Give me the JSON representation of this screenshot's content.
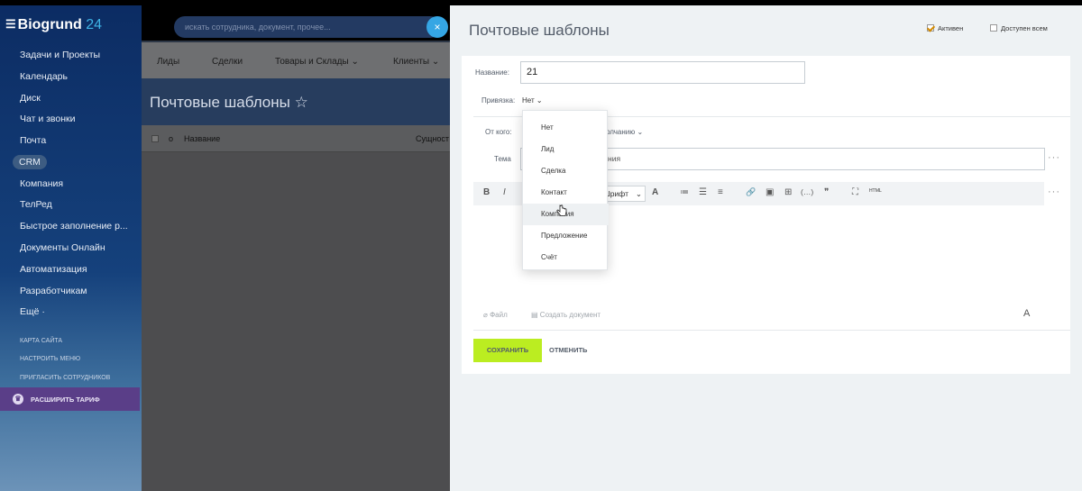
{
  "app": {
    "brand": "Biogrund",
    "brand_number": "24"
  },
  "search": {
    "placeholder": "искать сотрудника, документ, прочее...",
    "close_symbol": "×"
  },
  "sidebar": {
    "items": [
      {
        "label": "Задачи и Проекты"
      },
      {
        "label": "Календарь"
      },
      {
        "label": "Диск"
      },
      {
        "label": "Чат и звонки"
      },
      {
        "label": "Почта"
      },
      {
        "label": "CRM"
      },
      {
        "label": "Компания"
      },
      {
        "label": "ТелРед"
      },
      {
        "label": "Быстрое заполнение р..."
      },
      {
        "label": "Документы Онлайн"
      },
      {
        "label": "Автоматизация"
      },
      {
        "label": "Разработчикам"
      },
      {
        "label": "Ещё ·"
      }
    ],
    "links": [
      "КАРТА САЙТА",
      "НАСТРОИТЬ МЕНЮ",
      "ПРИГЛАСИТЬ СОТРУДНИКОВ"
    ],
    "upgrade_label": "РАСШИРИТЬ ТАРИФ"
  },
  "crm_tabs": [
    "Лиды",
    "Сделки",
    "Товары и Склады ⌄",
    "Клиенты ⌄"
  ],
  "page": {
    "title": "Почтовые шаблоны ☆"
  },
  "table": {
    "col_o": "о",
    "col_name": "Название",
    "col_entity": "Сущност"
  },
  "slider": {
    "title": "Почтовые шаблоны",
    "active_label": "Активен",
    "active_checked": true,
    "public_label": "Доступен всем",
    "public_checked": false
  },
  "form": {
    "name_label": "Название:",
    "name_value": "21",
    "binding_label": "Привязка:",
    "binding_value": "Нет",
    "from_label": "От кого:",
    "from_value": "олчанию ⌄",
    "subject_label": "Тема",
    "subject_value": "ния",
    "more": "···",
    "font_value": "Шрифт",
    "toolbar": {
      "bold": "B",
      "italic": "I",
      "fontsize": "A",
      "ol": "≔",
      "ul": "☰",
      "align": "≡",
      "link": "🔗",
      "image": "▣",
      "table": "⊞",
      "code": "(…)",
      "quote": "❞",
      "fullscreen": "⛶",
      "html": "ᴴᵀᴹᴸ"
    },
    "file_label": "Файл",
    "create_doc_label": "Создать документ",
    "text_tool": "A",
    "save_label": "СОХРАНИТЬ",
    "cancel_label": "ОТМЕНИТЬ"
  },
  "dropdown": {
    "items": [
      "Нет",
      "Лид",
      "Сделка",
      "Контакт",
      "Компания",
      "Предложение",
      "Счёт"
    ],
    "hovered": "Компания"
  },
  "colors": {
    "accent_green": "#bbed21",
    "sidebar_blue": "#15417c",
    "upgrade_purple": "#5a3e88",
    "link_blue": "#3fb4e6"
  }
}
